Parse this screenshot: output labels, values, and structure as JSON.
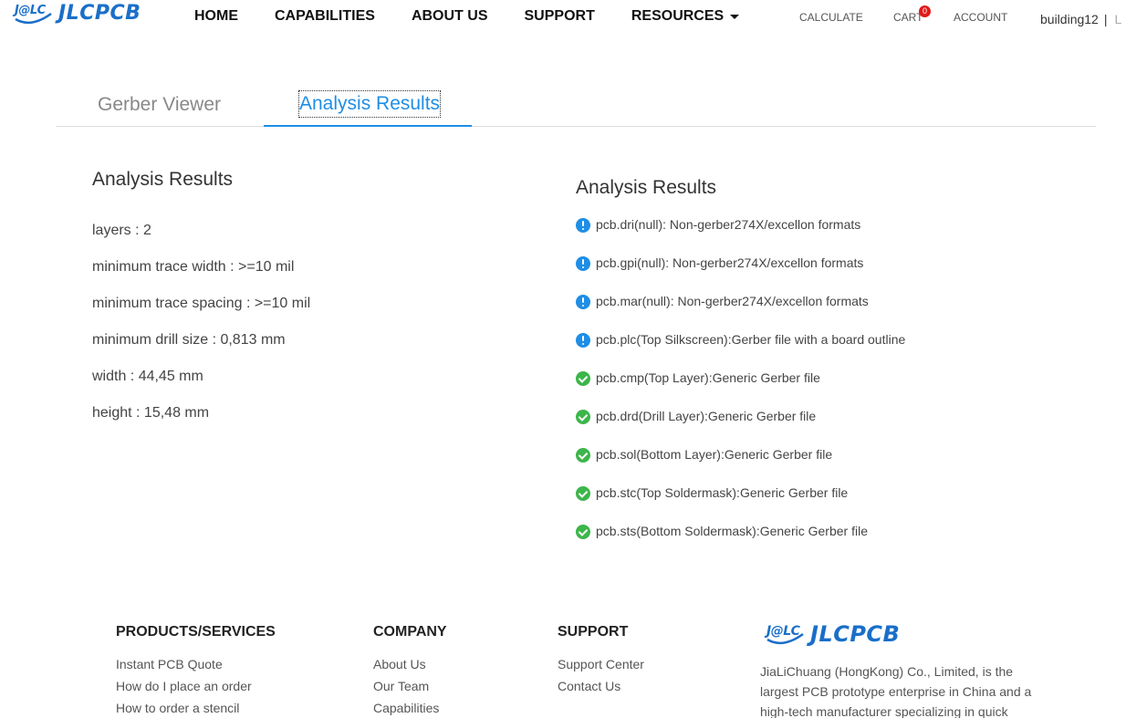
{
  "header": {
    "logo_badge": "J@LC",
    "logo_word": "JLCPCB",
    "nav": [
      "HOME",
      "CAPABILITIES",
      "ABOUT US",
      "SUPPORT",
      "RESOURCES"
    ],
    "calculate": "CALCULATE",
    "cart": "CART",
    "cart_count": "0",
    "account": "ACCOUNT",
    "username": "building12",
    "separator": "|",
    "cut_text": "L"
  },
  "tabs": {
    "gerber_viewer": "Gerber Viewer",
    "analysis_results": "Analysis Results",
    "active": "analysis_results"
  },
  "left": {
    "title": "Analysis Results",
    "rows": [
      "layers : 2",
      "minimum trace width : >=10 mil",
      "minimum trace spacing : >=10 mil",
      "minimum drill size : 0,813 mm",
      "width : 44,45 mm",
      "height : 15,48 mm"
    ]
  },
  "right": {
    "title": "Analysis Results",
    "files": [
      {
        "status": "info",
        "text": "pcb.dri(null): Non-gerber274X/excellon formats"
      },
      {
        "status": "info",
        "text": "pcb.gpi(null): Non-gerber274X/excellon formats"
      },
      {
        "status": "info",
        "text": "pcb.mar(null): Non-gerber274X/excellon formats"
      },
      {
        "status": "info",
        "text": "pcb.plc(Top Silkscreen):Gerber file with a board outline"
      },
      {
        "status": "ok",
        "text": "pcb.cmp(Top Layer):Generic Gerber file"
      },
      {
        "status": "ok",
        "text": "pcb.drd(Drill Layer):Generic Gerber file"
      },
      {
        "status": "ok",
        "text": "pcb.sol(Bottom Layer):Generic Gerber file"
      },
      {
        "status": "ok",
        "text": "pcb.stc(Top Soldermask):Generic Gerber file"
      },
      {
        "status": "ok",
        "text": "pcb.sts(Bottom Soldermask):Generic Gerber file"
      }
    ]
  },
  "footer": {
    "products": {
      "heading": "PRODUCTS/SERVICES",
      "links": [
        "Instant PCB Quote",
        "How do I place an order",
        "How to order a stencil"
      ]
    },
    "company": {
      "heading": "COMPANY",
      "links": [
        "About Us",
        "Our Team",
        "Capabilities"
      ]
    },
    "support": {
      "heading": "SUPPORT",
      "links": [
        "Support Center",
        "Contact Us"
      ]
    },
    "logo_badge": "J@LC",
    "logo_word": "JLCPCB",
    "about": "JiaLiChuang (HongKong) Co., Limited, is the largest PCB prototype enterprise in China and a high-tech manufacturer specializing in quick"
  },
  "colors": {
    "brand_blue": "#1a6fc8",
    "tab_active": "#1e8ee6",
    "info_icon": "#1e8ee6",
    "ok_icon": "#3cb54a",
    "cart_badge": "#e01a1a"
  }
}
